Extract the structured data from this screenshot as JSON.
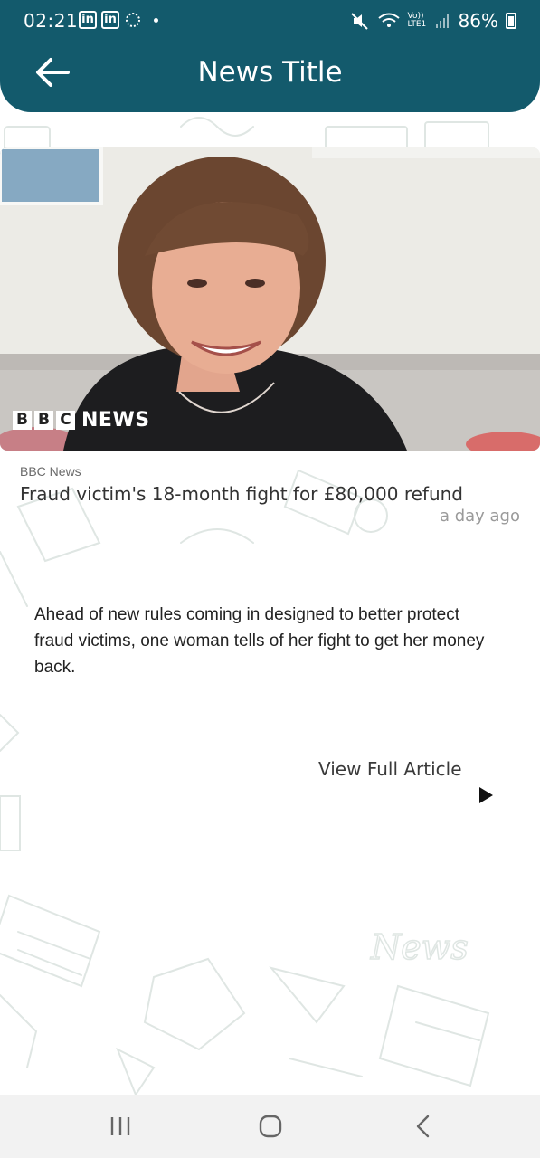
{
  "status_bar": {
    "time": "02:21",
    "battery": "86%",
    "network_label": "Vo)) LTE1"
  },
  "header": {
    "title": "News Title"
  },
  "article": {
    "image_logo": {
      "bbc_letters": [
        "B",
        "B",
        "C"
      ],
      "news_word": "NEWS"
    },
    "source": "BBC News",
    "headline": "Fraud victim's 18-month fight for £80,000 refund",
    "time_ago": "a day ago",
    "summary": "Ahead of new rules coming in designed to better protect fraud victims, one woman tells of her fight to get her money back.",
    "cta_label": "View Full Article"
  },
  "colors": {
    "header_bg": "#135a6c",
    "nav_bg": "#f2f2f2"
  },
  "icons": {
    "back": "arrow-left-icon",
    "play": "play-icon",
    "nav_recent": "recent-apps-icon",
    "nav_home": "home-icon",
    "nav_back": "chevron-left-icon"
  }
}
